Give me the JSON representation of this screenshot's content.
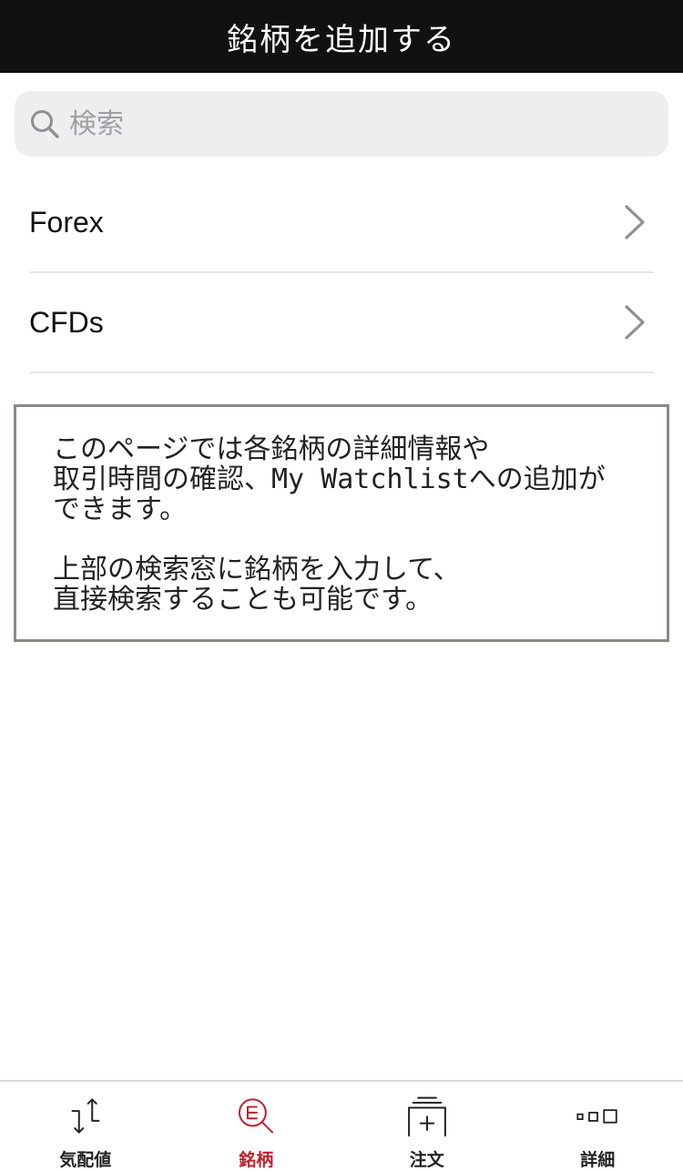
{
  "header": {
    "title": "銘柄を追加する"
  },
  "search": {
    "placeholder": "検索",
    "value": ""
  },
  "list": {
    "items": [
      {
        "label": "Forex"
      },
      {
        "label": "CFDs"
      }
    ]
  },
  "info": {
    "paragraph1": "このページでは各銘柄の詳細情報や\n取引時間の確認、My Watchlistへの追加が\nできます。",
    "paragraph2": "上部の検索窓に銘柄を入力して、\n直接検索することも可能です。"
  },
  "tabbar": {
    "tabs": [
      {
        "label": "気配値",
        "icon": "quote-arrows-icon"
      },
      {
        "label": "銘柄",
        "icon": "symbol-search-icon",
        "active": true
      },
      {
        "label": "注文",
        "icon": "order-add-icon"
      },
      {
        "label": "詳細",
        "icon": "more-squares-icon"
      }
    ]
  },
  "colors": {
    "header_bg": "#111111",
    "accent": "#c0202f",
    "box_border": "#8f8781",
    "search_bg": "#eeeeef"
  }
}
